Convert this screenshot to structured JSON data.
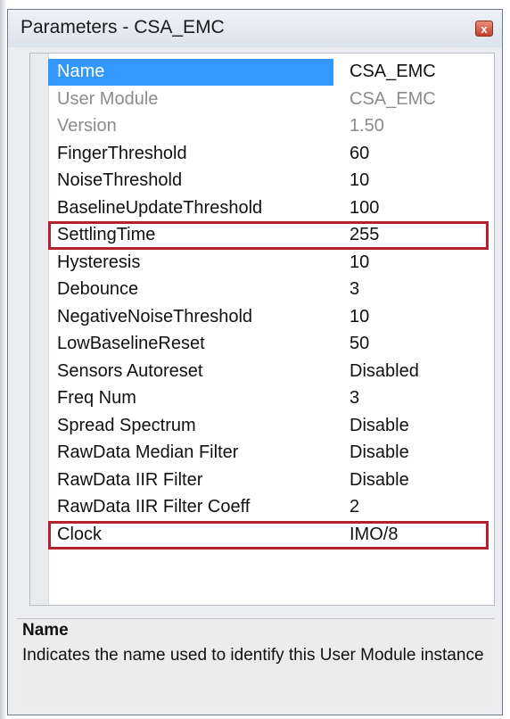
{
  "window": {
    "title": "Parameters - CSA_EMC",
    "close_glyph": "x"
  },
  "parameters": [
    {
      "name": "Name",
      "value": "CSA_EMC",
      "state": "selected"
    },
    {
      "name": "User Module",
      "value": "CSA_EMC",
      "state": "readonly"
    },
    {
      "name": "Version",
      "value": "1.50",
      "state": "readonly"
    },
    {
      "name": "FingerThreshold",
      "value": "60",
      "state": "normal"
    },
    {
      "name": "NoiseThreshold",
      "value": "10",
      "state": "normal"
    },
    {
      "name": "BaselineUpdateThreshold",
      "value": "100",
      "state": "normal"
    },
    {
      "name": "SettlingTime",
      "value": "255",
      "state": "highlighted"
    },
    {
      "name": "Hysteresis",
      "value": "10",
      "state": "normal"
    },
    {
      "name": "Debounce",
      "value": "3",
      "state": "normal"
    },
    {
      "name": "NegativeNoiseThreshold",
      "value": "10",
      "state": "normal"
    },
    {
      "name": "LowBaselineReset",
      "value": "50",
      "state": "normal"
    },
    {
      "name": "Sensors Autoreset",
      "value": "Disabled",
      "state": "normal"
    },
    {
      "name": "Freq Num",
      "value": "3",
      "state": "normal"
    },
    {
      "name": "Spread Spectrum",
      "value": "Disable",
      "state": "normal"
    },
    {
      "name": "RawData Median Filter",
      "value": "Disable",
      "state": "normal"
    },
    {
      "name": "RawData IIR Filter",
      "value": "Disable",
      "state": "normal"
    },
    {
      "name": "RawData IIR Filter Coeff",
      "value": "2",
      "state": "normal"
    },
    {
      "name": "Clock",
      "value": "IMO/8",
      "state": "highlighted"
    }
  ],
  "description": {
    "title": "Name",
    "text": "Indicates the name used to identify this User Module instance"
  },
  "colors": {
    "selection": "#3399ff",
    "highlight_border": "#b3202e",
    "readonly_text": "#8c8c8c"
  }
}
